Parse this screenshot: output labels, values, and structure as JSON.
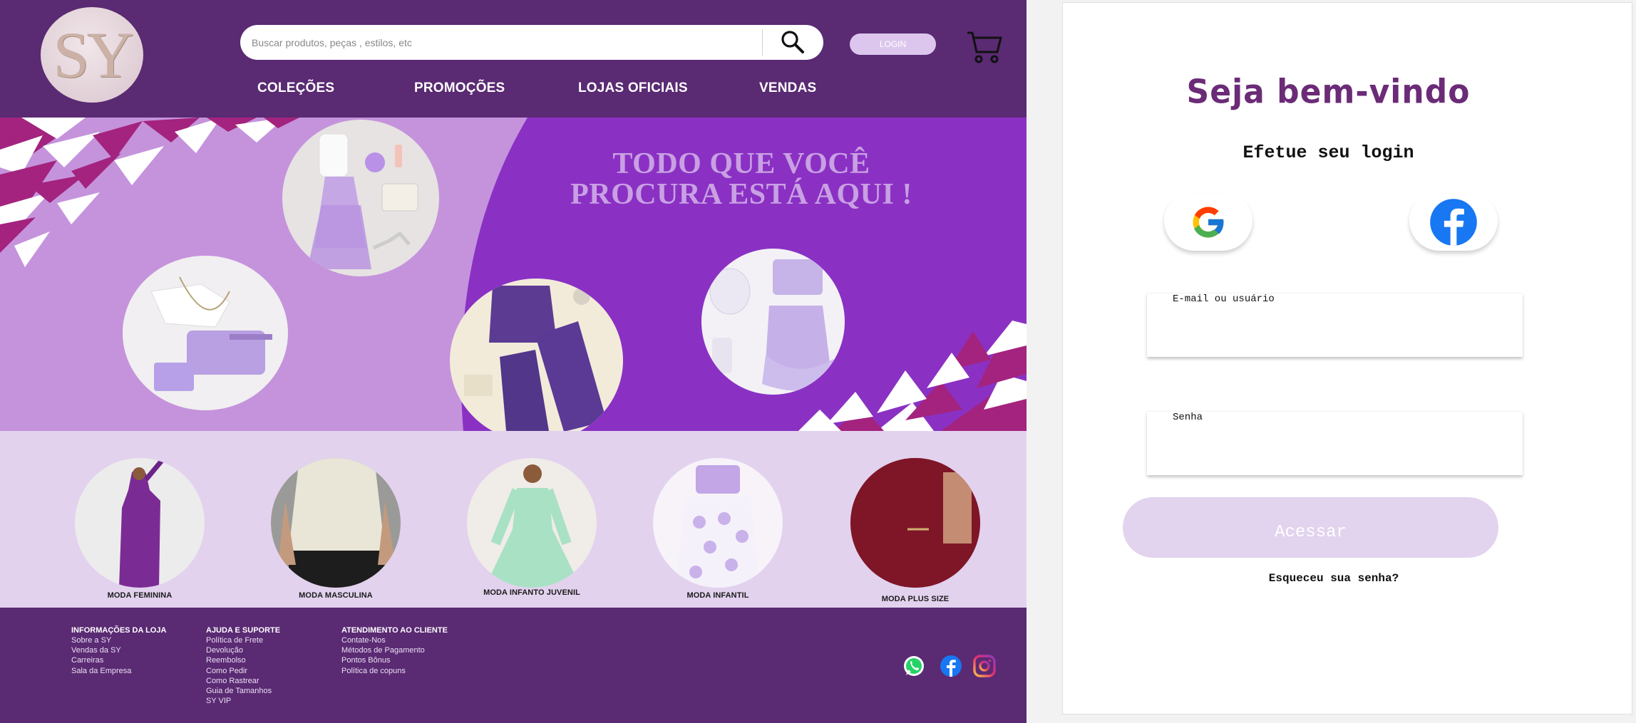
{
  "header": {
    "logo_text": "SY",
    "search_placeholder": "Buscar produtos, peças , estilos, etc",
    "login_label": "LOGIN",
    "nav": [
      "COLEÇÕES",
      "PROMOÇÕES",
      "LOJAS OFICIAIS",
      "VENDAS"
    ]
  },
  "banner": {
    "title_line1": "TODO QUE VOCÊ",
    "title_line2": "PROCURA ESTÁ AQUI !"
  },
  "categories": [
    {
      "label": "MODA FEMININA"
    },
    {
      "label": "MODA MASCULINA"
    },
    {
      "label": "MODA INFANTO JUVENIL"
    },
    {
      "label": "MODA INFANTIL"
    },
    {
      "label": "MODA PLUS SIZE"
    }
  ],
  "footer": {
    "columns": [
      {
        "title": "INFORMAÇÕES DA LOJA",
        "links": [
          "Sobre a SY",
          "Vendas da SY",
          "Carreiras",
          "Sala da Empresa"
        ]
      },
      {
        "title": "AJUDA E SUPORTE",
        "links": [
          "Política de Frete",
          "Devolução",
          "Reembolso",
          "Como Pedir",
          "Como Rastrear",
          "Guia de Tamanhos",
          "SY VIP"
        ]
      },
      {
        "title": "ATENDIMENTO AO CLIENTE",
        "links": [
          "Contate-Nos",
          "Métodos de Pagamento",
          "Pontos Bônus",
          "Política de copuns"
        ]
      }
    ],
    "social_icons": [
      "whatsapp-icon",
      "facebook-icon",
      "instagram-icon"
    ]
  },
  "login": {
    "title": "Seja bem-vindo",
    "subtitle": "Efetue seu login",
    "email_label": "E-mail ou usuário",
    "email_value": "",
    "password_label": "Senha",
    "password_value": "",
    "submit_label": "Acessar",
    "forgot_label": "Esqueceu sua senha?"
  },
  "colors": {
    "brand_purple": "#5a2a73",
    "banner_lilac": "#c593dc",
    "banner_violet": "#8a31c4",
    "category_bg": "#e2d2ee",
    "title_purple": "#6b2b77",
    "button_lilac": "#e2d3ee"
  }
}
